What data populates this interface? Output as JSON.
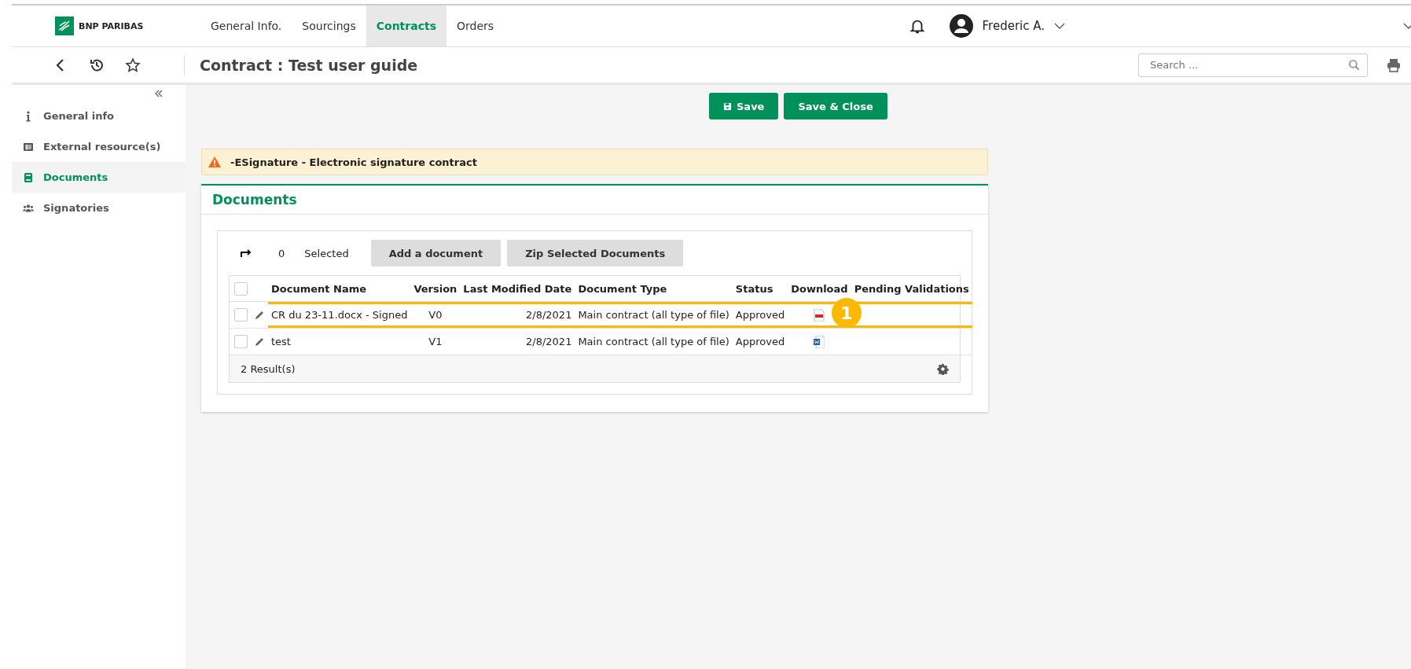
{
  "brand": {
    "name": "BNP PARIBAS"
  },
  "nav": [
    {
      "label": "General Info.",
      "selected": false
    },
    {
      "label": "Sourcings",
      "selected": false
    },
    {
      "label": "Contracts",
      "selected": true
    },
    {
      "label": "Orders",
      "selected": false
    }
  ],
  "user": {
    "name": "Frederic A."
  },
  "page_title": "Contract : Test user guide",
  "search": {
    "placeholder": "Search ..."
  },
  "sidebar": [
    {
      "label": "General info",
      "kind": "info",
      "selected": false
    },
    {
      "label": "External resource(s)",
      "kind": "list",
      "selected": false
    },
    {
      "label": "Documents",
      "kind": "book",
      "selected": true
    },
    {
      "label": "Signatories",
      "kind": "users",
      "selected": false
    }
  ],
  "actions": [
    "Save",
    "Save & Close"
  ],
  "alert": "-ESignature - Electronic signature contract",
  "section_title": "Documents",
  "toolbar": {
    "count": "0",
    "selected_label": "Selected",
    "buttons": [
      "Add a document",
      "Zip Selected Documents"
    ]
  },
  "table": {
    "all_checked": false,
    "columns": [
      "Document Name",
      "Version",
      "Last Modified Date",
      "Document Type",
      "Status",
      "Download",
      "Pending Validations"
    ],
    "rows": [
      {
        "checked": false,
        "name": "CR du 23-11.docx - Signed",
        "version": "V0",
        "date": "2/8/2021",
        "type": "Main contract (all type of file)",
        "status": "Approved",
        "kind": "pdf",
        "highlighted": true
      },
      {
        "checked": false,
        "name": "test",
        "version": "V1",
        "date": "2/8/2021",
        "type": "Main contract (all type of file)",
        "status": "Approved",
        "kind": "word",
        "highlighted": false
      }
    ],
    "footer": "2 Result(s)"
  },
  "callout": "1"
}
